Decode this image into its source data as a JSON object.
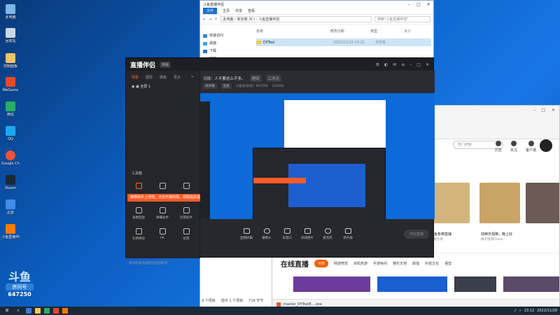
{
  "desktop": {
    "icons": [
      "此电脑",
      "回收站",
      "控制面板",
      "WeGame",
      "微信",
      "QQ",
      "Google Chrome",
      "Steam",
      "迅雷",
      "斗鱼直播伴侣"
    ]
  },
  "douyu_badge": {
    "logo": "斗鱼",
    "room": "房间号",
    "number": "647250"
  },
  "explorer": {
    "title": "斗鱼直播伴侣",
    "tabs": [
      "文件",
      "主页",
      "共享",
      "查看"
    ],
    "path": "此电脑 › 新加卷 (E:) › 斗鱼直播伴侣",
    "search_placeholder": "搜索\"斗鱼直播伴侣\"",
    "nav": [
      "快速访问",
      "桌面",
      "下载",
      "文档",
      "图片"
    ],
    "columns": [
      "名称",
      "修改日期",
      "类型",
      "大小"
    ],
    "rows": [
      {
        "name": "DYTool",
        "date": "2022/11/29 23:12",
        "type": "文件夹",
        "size": ""
      }
    ],
    "status": [
      "9 个项目",
      "选中 1 个项目",
      "719 字节"
    ]
  },
  "browser": {
    "search_placeholder": "热门搜索",
    "actions": [
      "历史",
      "关注",
      "客户端"
    ],
    "captions": [
      {
        "title": "斗鱼象棋直播",
        "sub": "象棋大师"
      },
      {
        "title": "前两天观棋，晚上好",
        "sub": "棋子找到Chess"
      }
    ],
    "live_heading": "在线直播",
    "live_tabs": [
      "全部",
      "网游竞技",
      "单机热游",
      "手游休闲",
      "娱乐天地",
      "颜值",
      "科技文化",
      "语音"
    ],
    "download_file": "master_DYToolE....exe"
  },
  "app": {
    "logo": "直播伴侣",
    "version": "新版",
    "left_tabs": [
      "场景",
      "图层",
      "模板",
      "更多"
    ],
    "scene": "全屏 1",
    "tools_label": "工具箱",
    "tools": [
      "视频连麦",
      "多人连麦",
      "精彩时刻",
      "录像回放",
      "弹幕助手",
      "房管助手",
      "礼物特效",
      "PK",
      "投票"
    ],
    "banner": "推荐助手上线啦，点击开播权限，领取提高直播收益",
    "footer": "如何把本机画面投到直播间7",
    "room_title": "马钱：人不要这么不多。",
    "room_id_label": "房间",
    "category": "二次元",
    "status_chips": [
      "未开播",
      "连麦"
    ],
    "fans_label": "斗鱼号(房号): 647250",
    "hot": "122560",
    "bottom": [
      "直播屏幕",
      "摄像头",
      "多窗口",
      "添加图片",
      "麦克风",
      "扬声器"
    ],
    "start_button": "开始直播"
  },
  "taskbar": {
    "time": "23:12",
    "date": "2022/11/29"
  }
}
